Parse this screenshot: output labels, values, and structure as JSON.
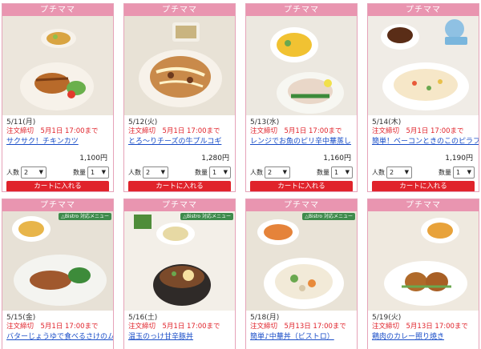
{
  "tag_label": "プチママ",
  "bistro_label": "△Bistro 対応メニュー",
  "labels": {
    "people": "人数",
    "qty": "数量",
    "cart": "カートに入れる"
  },
  "products": [
    {
      "date": "5/11(月)",
      "deadline": "注文締切　5月1日 17:00まで",
      "name": "サクサク！チキンカツ",
      "price": "1,100円",
      "people": "2",
      "qty": "1",
      "bistro": false
    },
    {
      "date": "5/12(火)",
      "deadline": "注文締切　5月1日 17:00まで",
      "name": "とろ〜りチーズの牛プルコギ",
      "price": "1,280円",
      "people": "2",
      "qty": "1",
      "bistro": false
    },
    {
      "date": "5/13(水)",
      "deadline": "注文締切　5月1日 17:00まで",
      "name": "レンジでお魚のピリ辛中華蒸し",
      "price": "1,160円",
      "people": "2",
      "qty": "1",
      "bistro": false
    },
    {
      "date": "5/14(木)",
      "deadline": "注文締切　5月1日 17:00まで",
      "name": "簡単！ベーコンときのこのピラフ",
      "price": "1,190円",
      "people": "2",
      "qty": "1",
      "bistro": false
    },
    {
      "date": "5/15(金)",
      "deadline": "注文締切　5月1日 17:00まで",
      "name": "バターじょうゆで食べるさけのムニエル（ビストロ）",
      "bistro": true
    },
    {
      "date": "5/16(土)",
      "deadline": "注文締切　5月1日 17:00まで",
      "name": "温玉のっけ甘辛豚丼",
      "bistro": true
    },
    {
      "date": "5/18(月)",
      "deadline": "注文締切　5月13日 17:00まで",
      "name": "簡単♪中華丼（ビストロ）",
      "bistro": true
    },
    {
      "date": "5/19(火)",
      "deadline": "注文締切　5月13日 17:00まで",
      "name": "鶏肉のカレー照り焼き",
      "bistro": false
    }
  ],
  "colors": {
    "tag_pink": "#e995b0",
    "border_pink": "#e6a3b9",
    "deadline_red": "#e0232b",
    "link_blue": "#1a4ec8",
    "cart_red": "#e0232b"
  }
}
